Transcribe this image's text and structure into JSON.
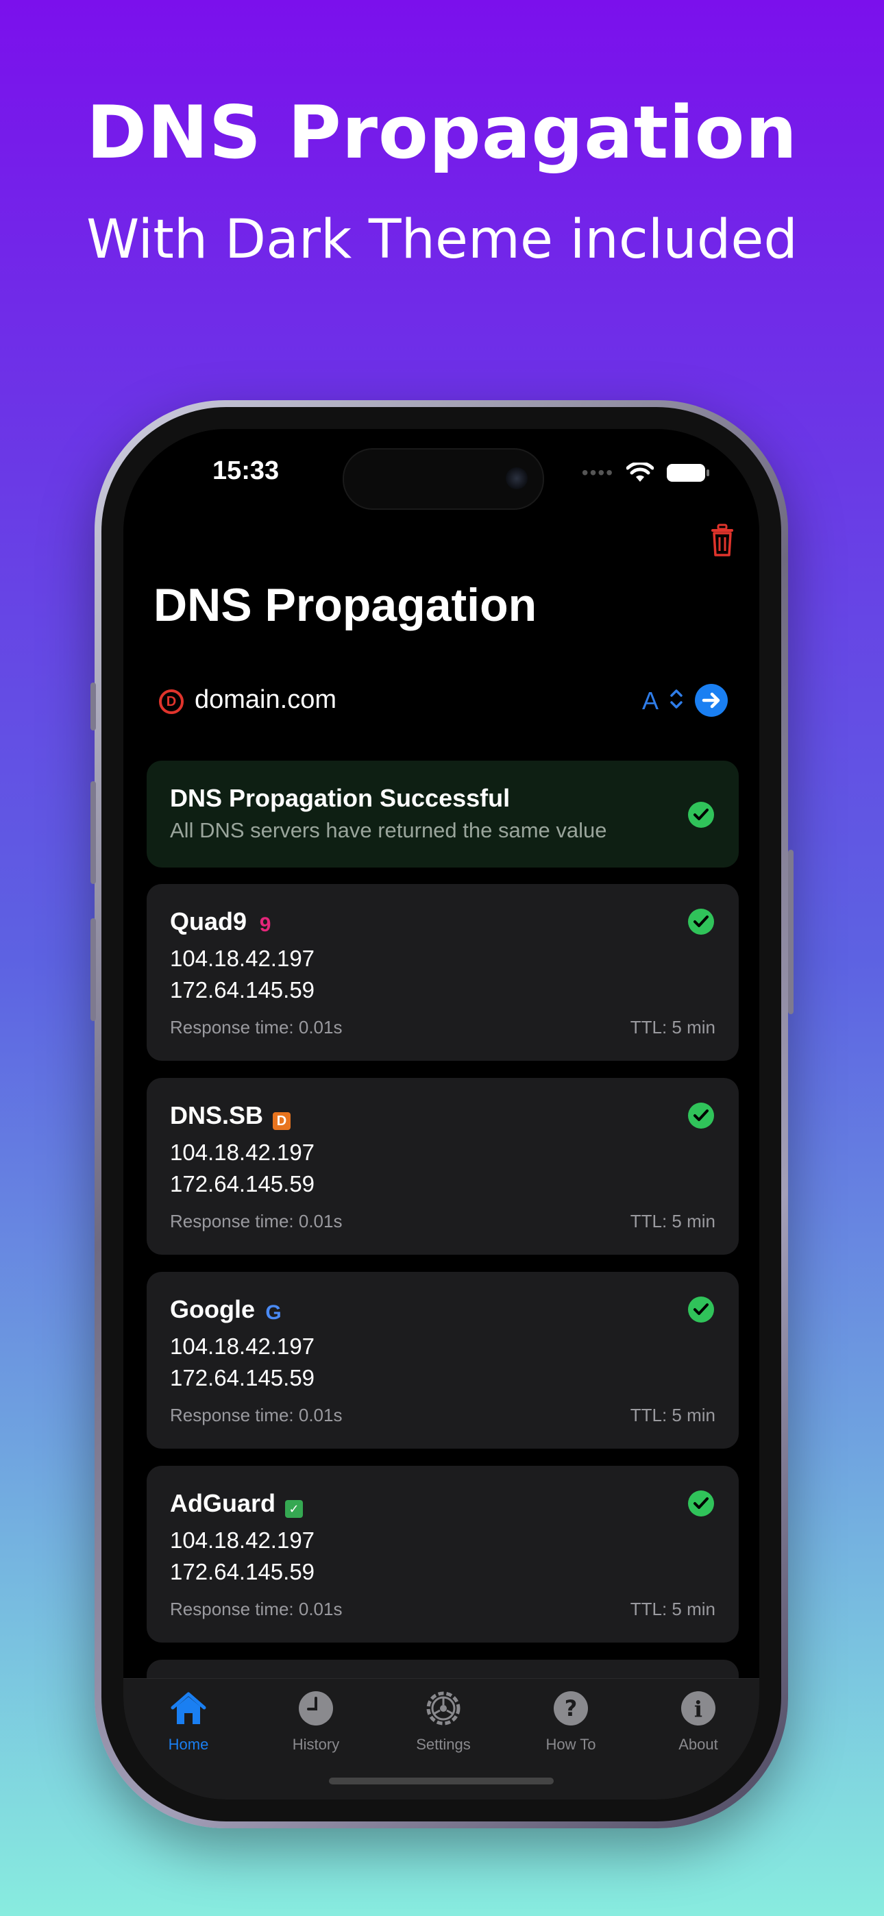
{
  "promo": {
    "headline": "DNS Propagation",
    "subline": "With Dark Theme included"
  },
  "status_bar": {
    "time": "15:33",
    "dots": "••••"
  },
  "app": {
    "title": "DNS Propagation",
    "domain": "domain.com",
    "record_type": "A",
    "domain_icon_letter": "D"
  },
  "success": {
    "title": "DNS Propagation Successful",
    "subtitle": "All DNS servers have returned the same value"
  },
  "servers": [
    {
      "name": "Quad9",
      "logo": "9",
      "ip1": "104.18.42.197",
      "ip2": "172.64.145.59",
      "response": "Response time: 0.01s",
      "ttl": "TTL: 5 min"
    },
    {
      "name": "DNS.SB",
      "logo": "D",
      "ip1": "104.18.42.197",
      "ip2": "172.64.145.59",
      "response": "Response time: 0.01s",
      "ttl": "TTL: 5 min"
    },
    {
      "name": "Google",
      "logo": "G",
      "ip1": "104.18.42.197",
      "ip2": "172.64.145.59",
      "response": "Response time: 0.01s",
      "ttl": "TTL: 5 min"
    },
    {
      "name": "AdGuard",
      "logo": "✓",
      "ip1": "104.18.42.197",
      "ip2": "172.64.145.59",
      "response": "Response time: 0.01s",
      "ttl": "TTL: 5 min"
    }
  ],
  "tabs": [
    {
      "label": "Home",
      "icon": "house-icon"
    },
    {
      "label": "History",
      "icon": "clock-icon"
    },
    {
      "label": "Settings",
      "icon": "gear-icon"
    },
    {
      "label": "How To",
      "icon": "question-icon"
    },
    {
      "label": "About",
      "icon": "info-icon"
    }
  ],
  "colors": {
    "accent": "#1a7ff2",
    "success": "#30c35a",
    "danger": "#e0342c",
    "card": "#1c1c1e"
  }
}
